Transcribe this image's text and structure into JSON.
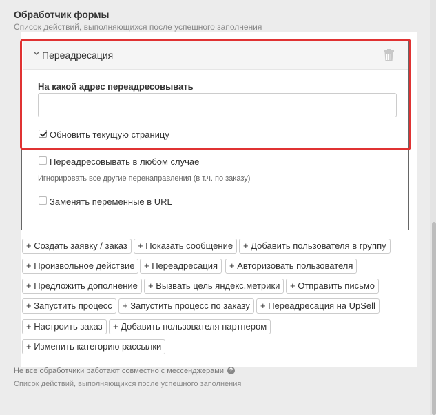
{
  "section": {
    "title": "Обработчик формы",
    "subtitle": "Список действий, выполняющихся после успешного заполнения"
  },
  "handler": {
    "title": "Переадресация",
    "chevron_icon": "chevron-down-icon",
    "delete_icon": "trash-icon",
    "field_label": "На какой адрес переадресовывать",
    "url_value": "",
    "refresh_label": "Обновить текущую страницу",
    "refresh_checked": true,
    "always_label": "Переадресовывать в любом случае",
    "always_checked": false,
    "always_hint": "Игнорировать все другие перенаправления (в т.ч. по заказу)",
    "replace_label": "Заменять переменные в URL",
    "replace_checked": false
  },
  "actions": [
    "+ Создать заявку / заказ",
    "+ Показать сообщение",
    "+ Добавить пользователя в группу",
    "+ Произвольное действие",
    "+ Переадресация",
    "+ Авторизовать пользователя",
    "+ Предложить дополнение",
    "+ Вызвать цель яндекс.метрики",
    "+ Отправить письмо",
    "+ Запустить процесс",
    "+ Запустить процесс по заказу",
    "+ Переадресация на UpSell",
    "+ Настроить заказ",
    "+ Добавить пользователя партнером",
    "+ Изменить категорию рассылки"
  ],
  "footer": {
    "note": "Не все обработчики работают совместно с мессенджерами",
    "help_icon": "question-circle-icon",
    "subtitle": "Список действий, выполняющихся после успешного заполнения"
  },
  "colors": {
    "highlight": "#e03232",
    "panel_bg": "#ffffff",
    "page_bg": "#ececec"
  }
}
